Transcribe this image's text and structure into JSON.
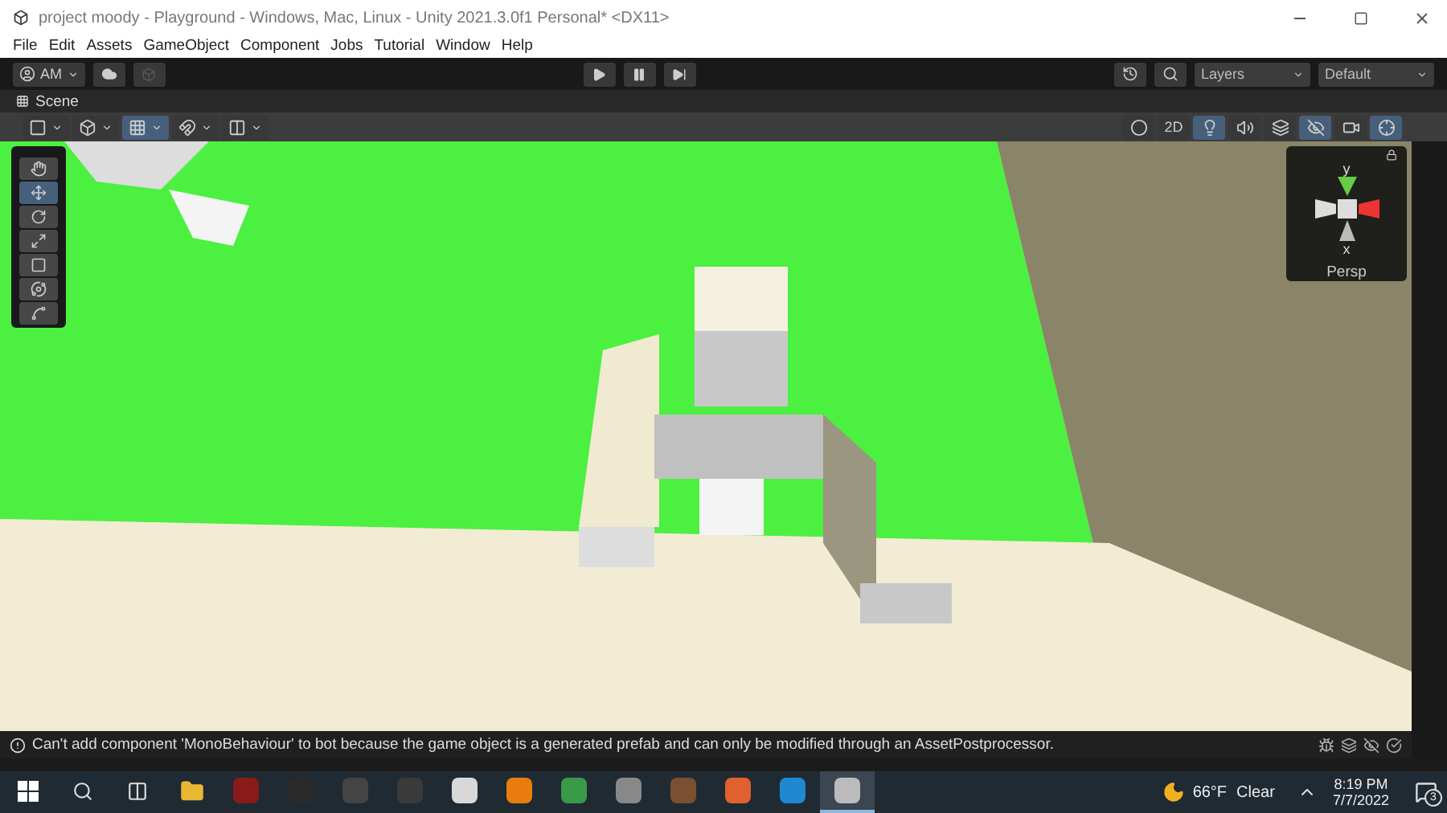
{
  "window": {
    "title": "project moody - Playground - Windows, Mac, Linux - Unity 2021.3.0f1 Personal* <DX11>"
  },
  "menu": [
    "File",
    "Edit",
    "Assets",
    "GameObject",
    "Component",
    "Jobs",
    "Tutorial",
    "Window",
    "Help"
  ],
  "toolbar": {
    "account": "AM",
    "layers": "Layers",
    "layout": "Default"
  },
  "scene_tab": {
    "label": "Scene"
  },
  "scene_toolbar": {
    "left": [
      {
        "kind": "draw",
        "selected": false
      },
      {
        "kind": "cube",
        "selected": false
      },
      {
        "kind": "grid",
        "selected": true
      },
      {
        "kind": "snap",
        "selected": false
      },
      {
        "kind": "increment",
        "selected": false
      }
    ],
    "right": [
      {
        "kind": "shading",
        "selected": false
      },
      {
        "kind": "text",
        "label": "2D",
        "selected": false
      },
      {
        "kind": "light",
        "selected": true
      },
      {
        "kind": "audio",
        "selected": false
      },
      {
        "kind": "fx",
        "selected": false
      },
      {
        "kind": "hidden",
        "selected": true
      },
      {
        "kind": "camera",
        "selected": false
      },
      {
        "kind": "gizmos",
        "selected": true
      }
    ]
  },
  "tools": [
    {
      "kind": "hand",
      "selected": false
    },
    {
      "kind": "move",
      "selected": true
    },
    {
      "kind": "rotate",
      "selected": false
    },
    {
      "kind": "scale",
      "selected": false
    },
    {
      "kind": "rect",
      "selected": false
    },
    {
      "kind": "transform",
      "selected": false
    },
    {
      "kind": "custom",
      "selected": false
    }
  ],
  "gizmo": {
    "y_label": "y",
    "x_label": "x",
    "projection": "Persp"
  },
  "status": {
    "message": "Can't add component 'MonoBehaviour' to bot because the game object is a generated prefab and can only be modified through an AssetPostprocessor."
  },
  "taskbar": {
    "apps": [
      {
        "kind": "task",
        "selected": false
      },
      {
        "kind": "folder",
        "selected": false
      },
      {
        "kind": "red",
        "selected": false
      },
      {
        "kind": "epic",
        "selected": false
      },
      {
        "kind": "obs",
        "selected": false
      },
      {
        "kind": "bolt",
        "selected": false
      },
      {
        "kind": "roblox",
        "selected": false
      },
      {
        "kind": "blender",
        "selected": false
      },
      {
        "kind": "chrome",
        "selected": false
      },
      {
        "kind": "unityhub",
        "selected": false
      },
      {
        "kind": "minecraft",
        "selected": false
      },
      {
        "kind": "firefox",
        "selected": false
      },
      {
        "kind": "edge",
        "selected": false
      },
      {
        "kind": "unity",
        "selected": true
      }
    ],
    "temperature": "66°F",
    "weather": "Clear",
    "time": "8:19 PM",
    "date": "7/7/2022",
    "notifications": "3"
  }
}
